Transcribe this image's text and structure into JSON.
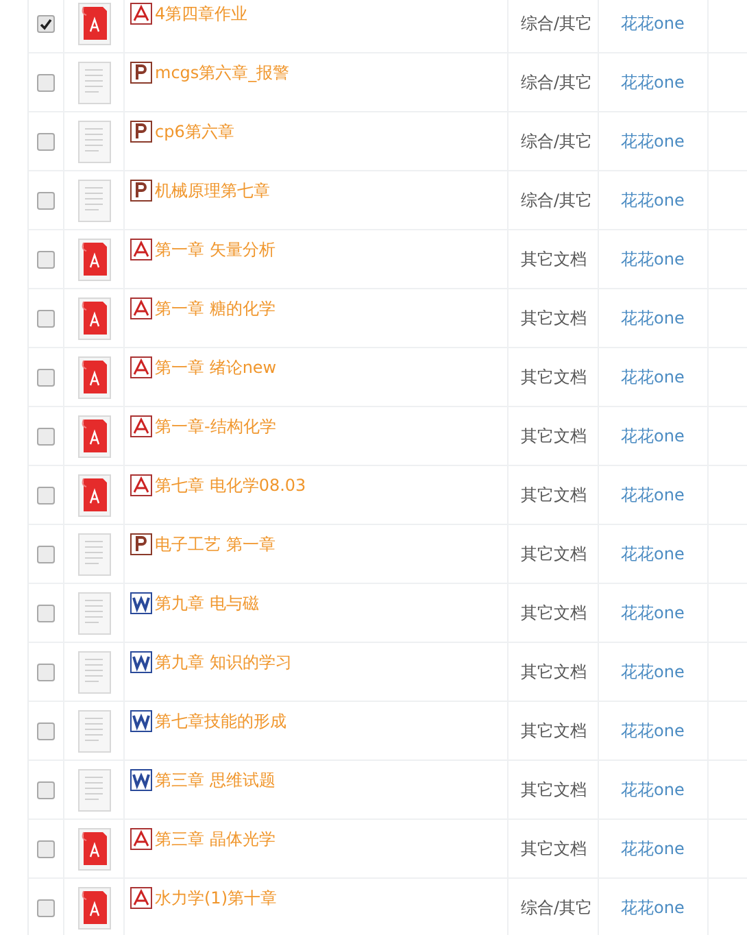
{
  "rows": [
    {
      "checked": true,
      "kind": "pdf",
      "title": "4第四章作业",
      "category": "综合/其它",
      "user": "花花one"
    },
    {
      "checked": false,
      "kind": "ppt",
      "title": "mcgs第六章_报警",
      "category": "综合/其它",
      "user": "花花one"
    },
    {
      "checked": false,
      "kind": "ppt",
      "title": "cp6第六章",
      "category": "综合/其它",
      "user": "花花one"
    },
    {
      "checked": false,
      "kind": "ppt",
      "title": "机械原理第七章",
      "category": "综合/其它",
      "user": "花花one"
    },
    {
      "checked": false,
      "kind": "pdf",
      "title": "第一章 矢量分析",
      "category": "其它文档",
      "user": "花花one"
    },
    {
      "checked": false,
      "kind": "pdf",
      "title": "第一章 糖的化学",
      "category": "其它文档",
      "user": "花花one"
    },
    {
      "checked": false,
      "kind": "pdf",
      "title": "第一章 绪论new",
      "category": "其它文档",
      "user": "花花one"
    },
    {
      "checked": false,
      "kind": "pdf",
      "title": "第一章-结构化学",
      "category": "其它文档",
      "user": "花花one"
    },
    {
      "checked": false,
      "kind": "pdf",
      "title": "第七章 电化学08.03",
      "category": "其它文档",
      "user": "花花one"
    },
    {
      "checked": false,
      "kind": "ppt",
      "title": "电子工艺 第一章",
      "category": "其它文档",
      "user": "花花one"
    },
    {
      "checked": false,
      "kind": "doc",
      "title": "第九章 电与磁",
      "category": "其它文档",
      "user": "花花one"
    },
    {
      "checked": false,
      "kind": "doc",
      "title": "第九章 知识的学习",
      "category": "其它文档",
      "user": "花花one"
    },
    {
      "checked": false,
      "kind": "doc",
      "title": "第七章技能的形成",
      "category": "其它文档",
      "user": "花花one"
    },
    {
      "checked": false,
      "kind": "doc",
      "title": "第三章 思维试题",
      "category": "其它文档",
      "user": "花花one"
    },
    {
      "checked": false,
      "kind": "pdf",
      "title": "第三章 晶体光学",
      "category": "其它文档",
      "user": "花花one"
    },
    {
      "checked": false,
      "kind": "pdf",
      "title": "水力学(1)第十章",
      "category": "综合/其它",
      "user": "花花one"
    }
  ]
}
